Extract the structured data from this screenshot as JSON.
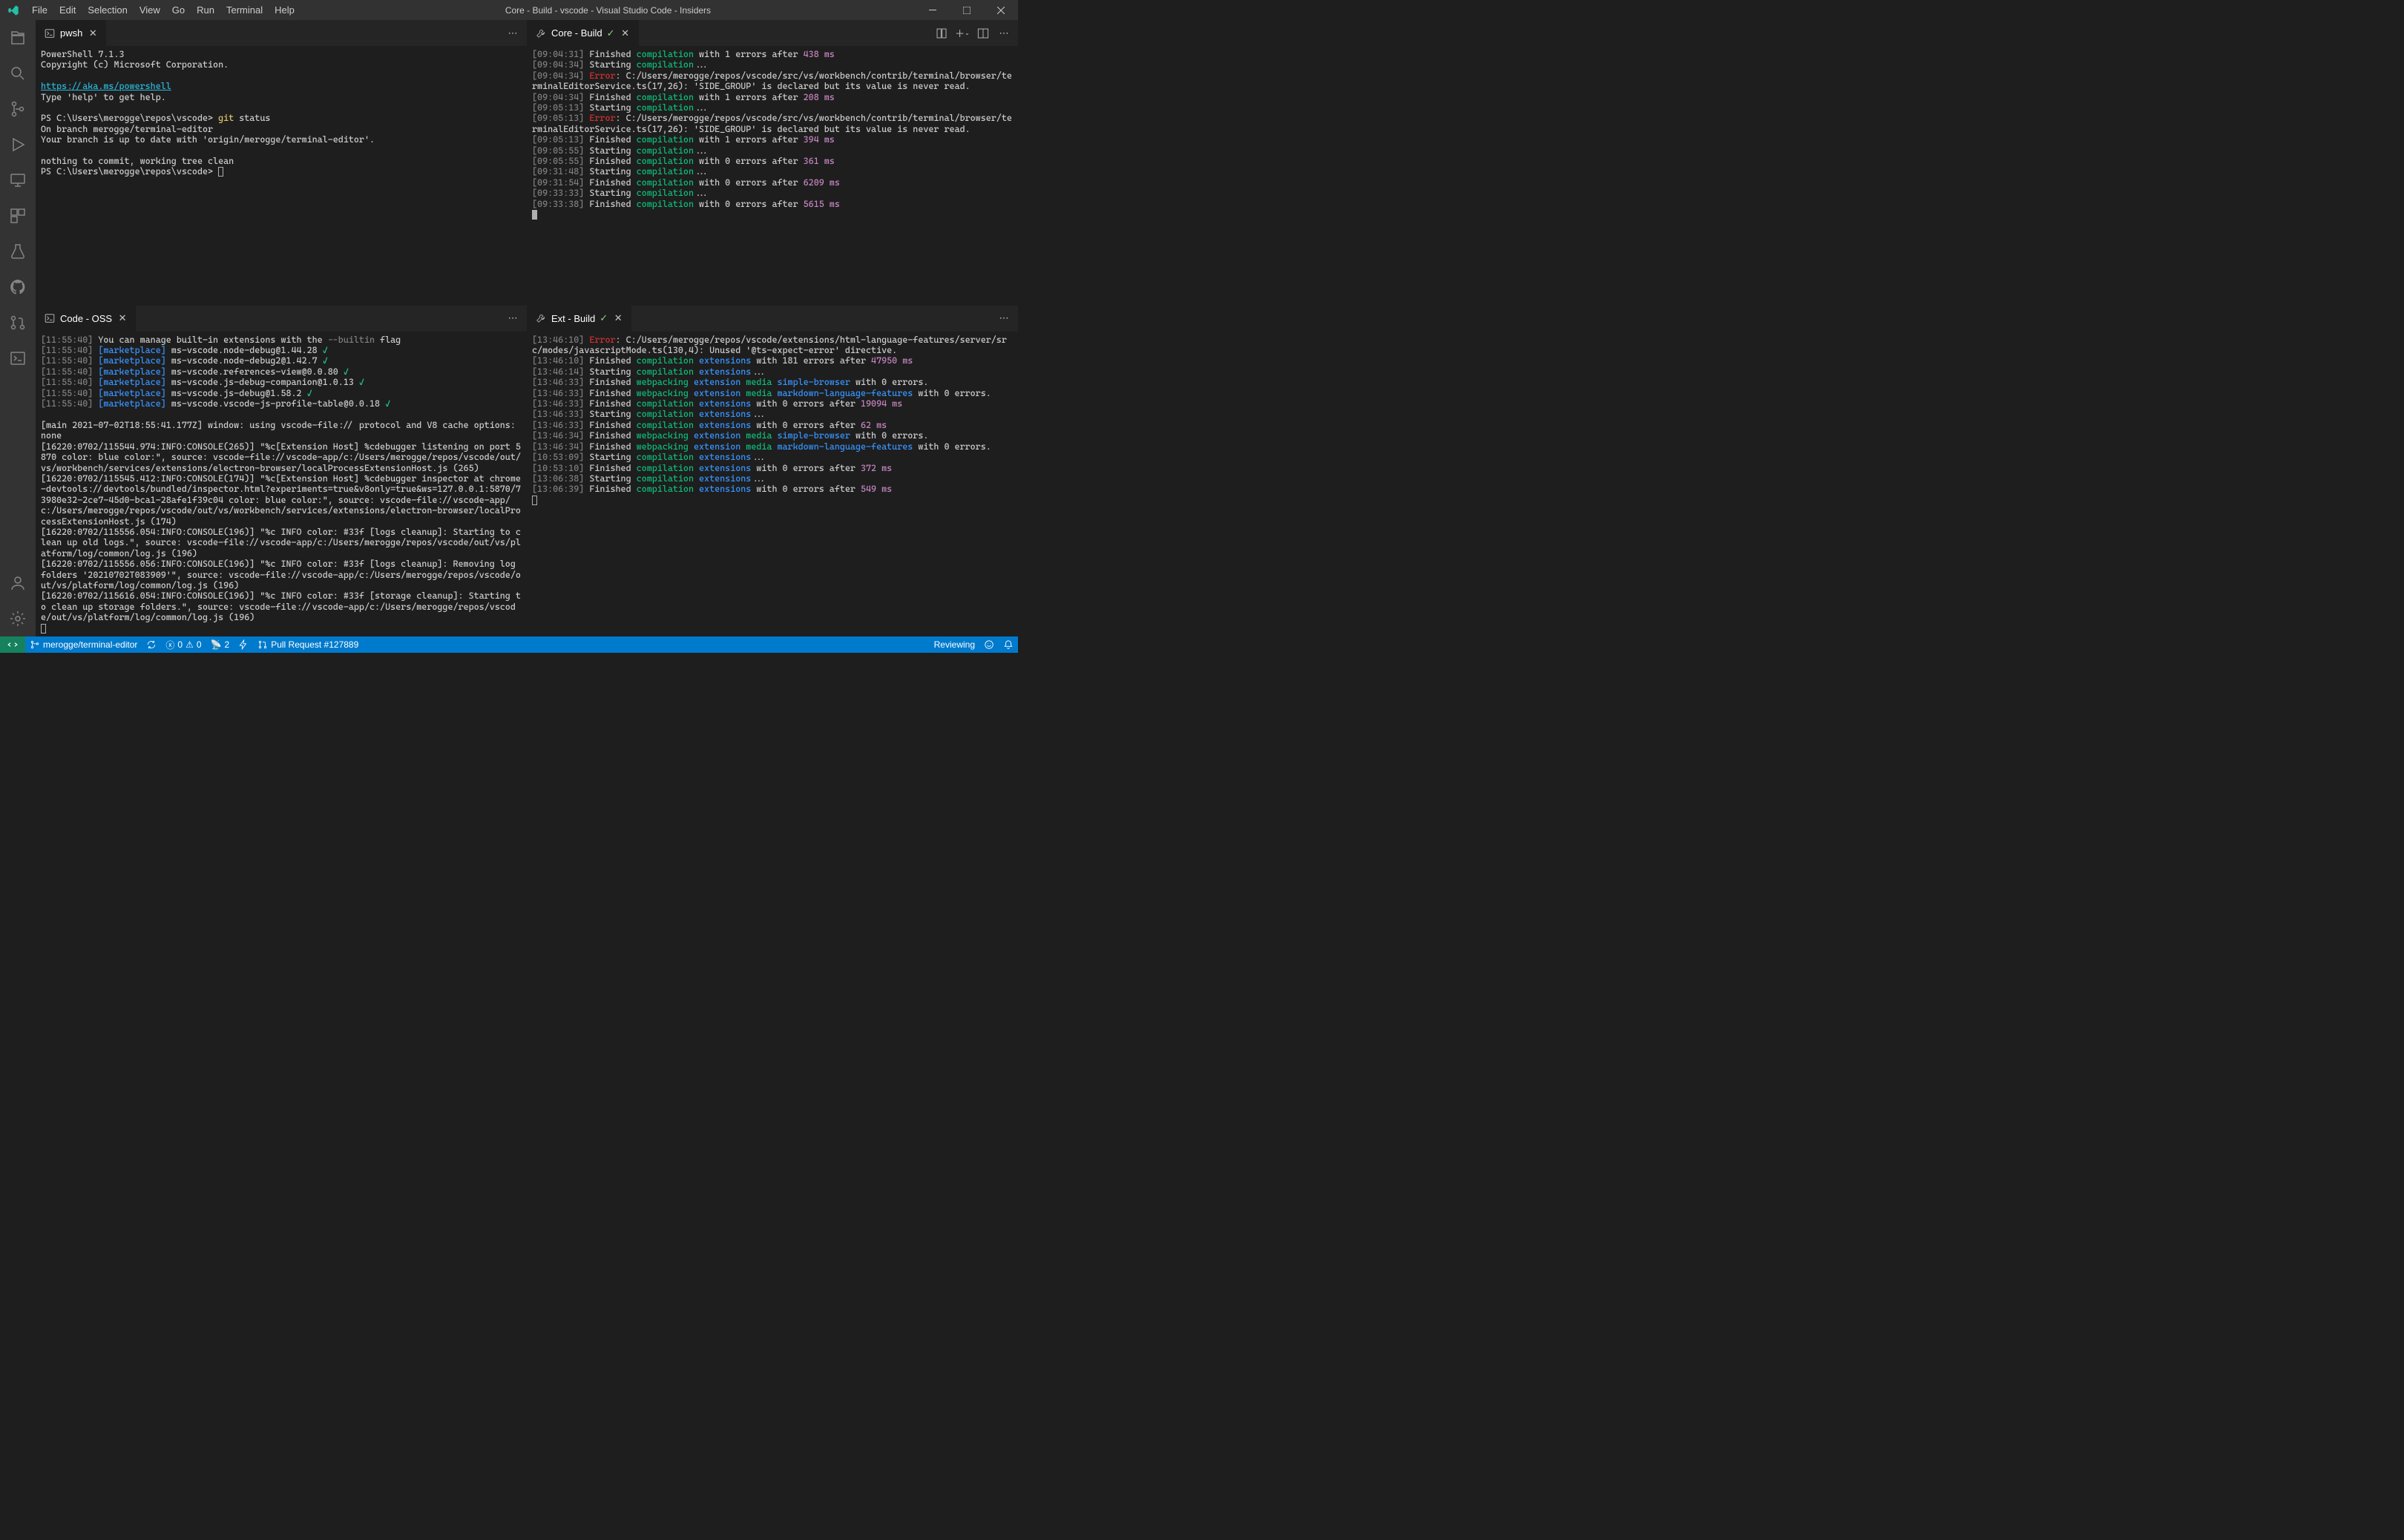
{
  "titlebar": {
    "menus": [
      "File",
      "Edit",
      "Selection",
      "View",
      "Go",
      "Run",
      "Terminal",
      "Help"
    ],
    "title": "Core - Build - vscode - Visual Studio Code - Insiders"
  },
  "activitybar": {
    "icons": [
      "files",
      "search",
      "source-control",
      "debug",
      "remote-explorer",
      "extensions",
      "test",
      "github",
      "pull-request",
      "terminal"
    ],
    "bottom": [
      "account",
      "gear"
    ]
  },
  "panes": {
    "topLeft": {
      "tab_label": "pwsh",
      "content": "PowerShell 7.1.3\nCopyright (c) Microsoft Corporation.\n\n<link>https://aka.ms/powershell</link>\nType 'help' to get help.\n\nPS C:\\Users\\merogge\\repos\\vscode> <cmd>git</cmd> status\nOn branch merogge/terminal-editor\nYour branch is up to date with 'origin/merogge/terminal-editor'.\n\nnothing to commit, working tree clean\nPS C:\\Users\\merogge\\repos\\vscode> <curout>"
    },
    "topRight": {
      "tab_label": "Core - Build",
      "content": "<gray>[09:04:31]</gray> Finished <green>compilation</green> with 1 errors after <mag>438 ms</mag>\n<gray>[09:04:34]</gray> Starting <green>compilation</green>...\n<gray>[09:04:34]</gray> <red>Error</red>: C:/Users/merogge/repos/vscode/src/vs/workbench/contrib/terminal/browser/terminalEditorService.ts(17,26): 'SIDE_GROUP' is declared but its value is never read.\n<gray>[09:04:34]</gray> Finished <green>compilation</green> with 1 errors after <mag>208 ms</mag>\n<gray>[09:05:13]</gray> Starting <green>compilation</green>...\n<gray>[09:05:13]</gray> <red>Error</red>: C:/Users/merogge/repos/vscode/src/vs/workbench/contrib/terminal/browser/terminalEditorService.ts(17,26): 'SIDE_GROUP' is declared but its value is never read.\n<gray>[09:05:13]</gray> Finished <green>compilation</green> with 1 errors after <mag>394 ms</mag>\n<gray>[09:05:55]</gray> Starting <green>compilation</green>...\n<gray>[09:05:55]</gray> Finished <green>compilation</green> with 0 errors after <mag>361 ms</mag>\n<gray>[09:31:48]</gray> Starting <green>compilation</green>...\n<gray>[09:31:54]</gray> Finished <green>compilation</green> with 0 errors after <mag>6209 ms</mag>\n<gray>[09:33:33]</gray> Starting <green>compilation</green>...\n<gray>[09:33:38]</gray> Finished <green>compilation</green> with 0 errors after <mag>5615 ms</mag>\n<cur>"
    },
    "bottomLeft": {
      "tab_label": "Code - OSS",
      "content": "<gray>[11:55:40]</gray> You can manage built-in extensions with the <flag>--builtin</flag> flag\n<gray>[11:55:40]</gray> <blue>[marketplace]</blue> ms-vscode.node-debug@1.44.28 <greenB>✓</greenB>\n<gray>[11:55:40]</gray> <blue>[marketplace]</blue> ms-vscode.node-debug2@1.42.7 <greenB>✓</greenB>\n<gray>[11:55:40]</gray> <blue>[marketplace]</blue> ms-vscode.references-view@0.0.80 <greenB>✓</greenB>\n<gray>[11:55:40]</gray> <blue>[marketplace]</blue> ms-vscode.js-debug-companion@1.0.13 <greenB>✓</greenB>\n<gray>[11:55:40]</gray> <blue>[marketplace]</blue> ms-vscode.js-debug@1.58.2 <greenB>✓</greenB>\n<gray>[11:55:40]</gray> <blue>[marketplace]</blue> ms-vscode.vscode-js-profile-table@0.0.18 <greenB>✓</greenB>\n\n[main 2021-07-02T18:55:41.177Z] window: using vscode-file:// protocol and V8 cache options: none\n[16220:0702/115544.974:INFO:CONSOLE(265)] \"%c[Extension Host] %cdebugger listening on port 5870 color: blue color:\", source: vscode-file://vscode-app/c:/Users/merogge/repos/vscode/out/vs/workbench/services/extensions/electron-browser/localProcessExtensionHost.js (265)\n[16220:0702/115545.412:INFO:CONSOLE(174)] \"%c[Extension Host] %cdebugger inspector at chrome-devtools://devtools/bundled/inspector.html?experiments=true&v8only=true&ws=127.0.0.1:5870/73980e32-2ce7-45d0-bca1-28afe1f39c04 color: blue color:\", source: vscode-file://vscode-app/c:/Users/merogge/repos/vscode/out/vs/workbench/services/extensions/electron-browser/localProcessExtensionHost.js (174)\n[16220:0702/115556.054:INFO:CONSOLE(196)] \"%c INFO color: #33f [logs cleanup]: Starting to clean up old logs.\", source: vscode-file://vscode-app/c:/Users/merogge/repos/vscode/out/vs/platform/log/common/log.js (196)\n[16220:0702/115556.056:INFO:CONSOLE(196)] \"%c INFO color: #33f [logs cleanup]: Removing log folders '20210702T083909'\", source: vscode-file://vscode-app/c:/Users/merogge/repos/vscode/out/vs/platform/log/common/log.js (196)\n[16220:0702/115616.054:INFO:CONSOLE(196)] \"%c INFO color: #33f [storage cleanup]: Starting to clean up storage folders.\", source: vscode-file://vscode-app/c:/Users/merogge/repos/vscode/out/vs/platform/log/common/log.js (196)\n<curout>"
    },
    "bottomRight": {
      "tab_label": "Ext - Build",
      "content": "<gray>[13:46:10]</gray> <red>Error</red>: C:/Users/merogge/repos/vscode/extensions/html-language-features/server/src/modes/javascriptMode.ts(130,4): Unused '@ts-expect-error' directive.\n<gray>[13:46:10]</gray> Finished <green>compilation</green> <blue>extensions</blue> with 181 errors after <mag>47950 ms</mag>\n<gray>[13:46:14]</gray> Starting <green>compilation</green> <blue>extensions</blue>...\n<gray>[13:46:33]</gray> Finished <green>webpacking</green> <blue>extension</blue> <green>media</green> <blue>simple-browser</blue> with 0 errors.\n<gray>[13:46:33]</gray> Finished <green>webpacking</green> <blue>extension</blue> <green>media</green> <blue>markdown-language-features</blue> with 0 errors.\n<gray>[13:46:33]</gray> Finished <green>compilation</green> <blue>extensions</blue> with 0 errors after <mag>19094 ms</mag>\n<gray>[13:46:33]</gray> Starting <green>compilation</green> <blue>extensions</blue>...\n<gray>[13:46:33]</gray> Finished <green>compilation</green> <blue>extensions</blue> with 0 errors after <mag>62 ms</mag>\n<gray>[13:46:34]</gray> Finished <green>webpacking</green> <blue>extension</blue> <green>media</green> <blue>simple-browser</blue> with 0 errors.\n<gray>[13:46:34]</gray> Finished <green>webpacking</green> <blue>extension</blue> <green>media</green> <blue>markdown-language-features</blue> with 0 errors.\n<gray>[10:53:09]</gray> Starting <green>compilation</green> <blue>extensions</blue>...\n<gray>[10:53:10]</gray> Finished <green>compilation</green> <blue>extensions</blue> with 0 errors after <mag>372 ms</mag>\n<gray>[13:06:38]</gray> Starting <green>compilation</green> <blue>extensions</blue>...\n<gray>[13:06:39]</gray> Finished <green>compilation</green> <blue>extensions</blue> with 0 errors after <mag>549 ms</mag>\n<curout>"
    }
  },
  "statusbar": {
    "branch": "merogge/terminal-editor",
    "sync": "⟳",
    "errors": "0",
    "warnings": "0",
    "ports": "2",
    "quickfix": "",
    "pull_request": "Pull Request #127889",
    "right": {
      "review": "Reviewing",
      "feedback": "",
      "bell": ""
    }
  },
  "colors": {
    "accent": "#007acc",
    "bg": "#1e1e1e",
    "tabbg": "#252526",
    "activity": "#333333",
    "timestamp": "#808080",
    "red": "#cd3131",
    "green": "#0dbc79",
    "blue": "#3794ff",
    "magenta": "#c586c0"
  }
}
